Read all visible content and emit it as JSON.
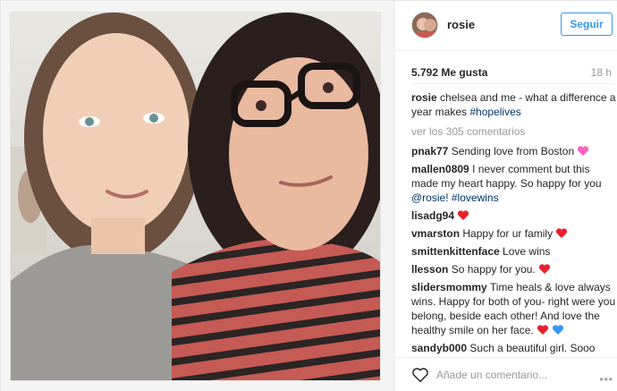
{
  "post": {
    "username": "rosie",
    "follow_label": "Seguir",
    "likes": "5.792 Me gusta",
    "time": "18 h",
    "caption": {
      "user": "rosie",
      "text": "chelsea and me - what a difference a year makes",
      "hashtag": "#hopelives"
    },
    "view_all": "ver los 305 comentarios",
    "comments": [
      {
        "user": "pnak77",
        "text": "Sending love from Boston",
        "emoji": "sparkle-heart"
      },
      {
        "user": "mallen0809",
        "text": "I never comment but this made my heart happy. So happy for you",
        "mention": "@rosie!",
        "hashtag": "#lovewins"
      },
      {
        "user": "lisadg94",
        "text": "",
        "emoji": "red-heart"
      },
      {
        "user": "vmarston",
        "text": "Happy for ur family",
        "emoji": "red-heart"
      },
      {
        "user": "smittenkittenface",
        "text": "Love wins"
      },
      {
        "user": "llesson",
        "text": "So happy for you.",
        "emoji": "red-heart"
      },
      {
        "user": "slidersmommy",
        "text": "Time heals & love always wins. Happy for both of you- right were you belong, beside each other! And love the healthy smile on her face.",
        "emoji": "red-blue-hearts"
      },
      {
        "user": "sandyb000",
        "text": "Such a beautiful girl. Sooo happy for you both Ro. Love always"
      }
    ],
    "comment_placeholder": "Añade un comentario...",
    "more_label": "•••"
  },
  "colors": {
    "accent": "#3897f0",
    "hashtag": "#003569",
    "muted": "#999999",
    "heart_red": "#ed4956",
    "heart_blue": "#3897f0"
  },
  "icons": {
    "like": "heart-outline-icon",
    "more": "ellipsis-icon"
  }
}
